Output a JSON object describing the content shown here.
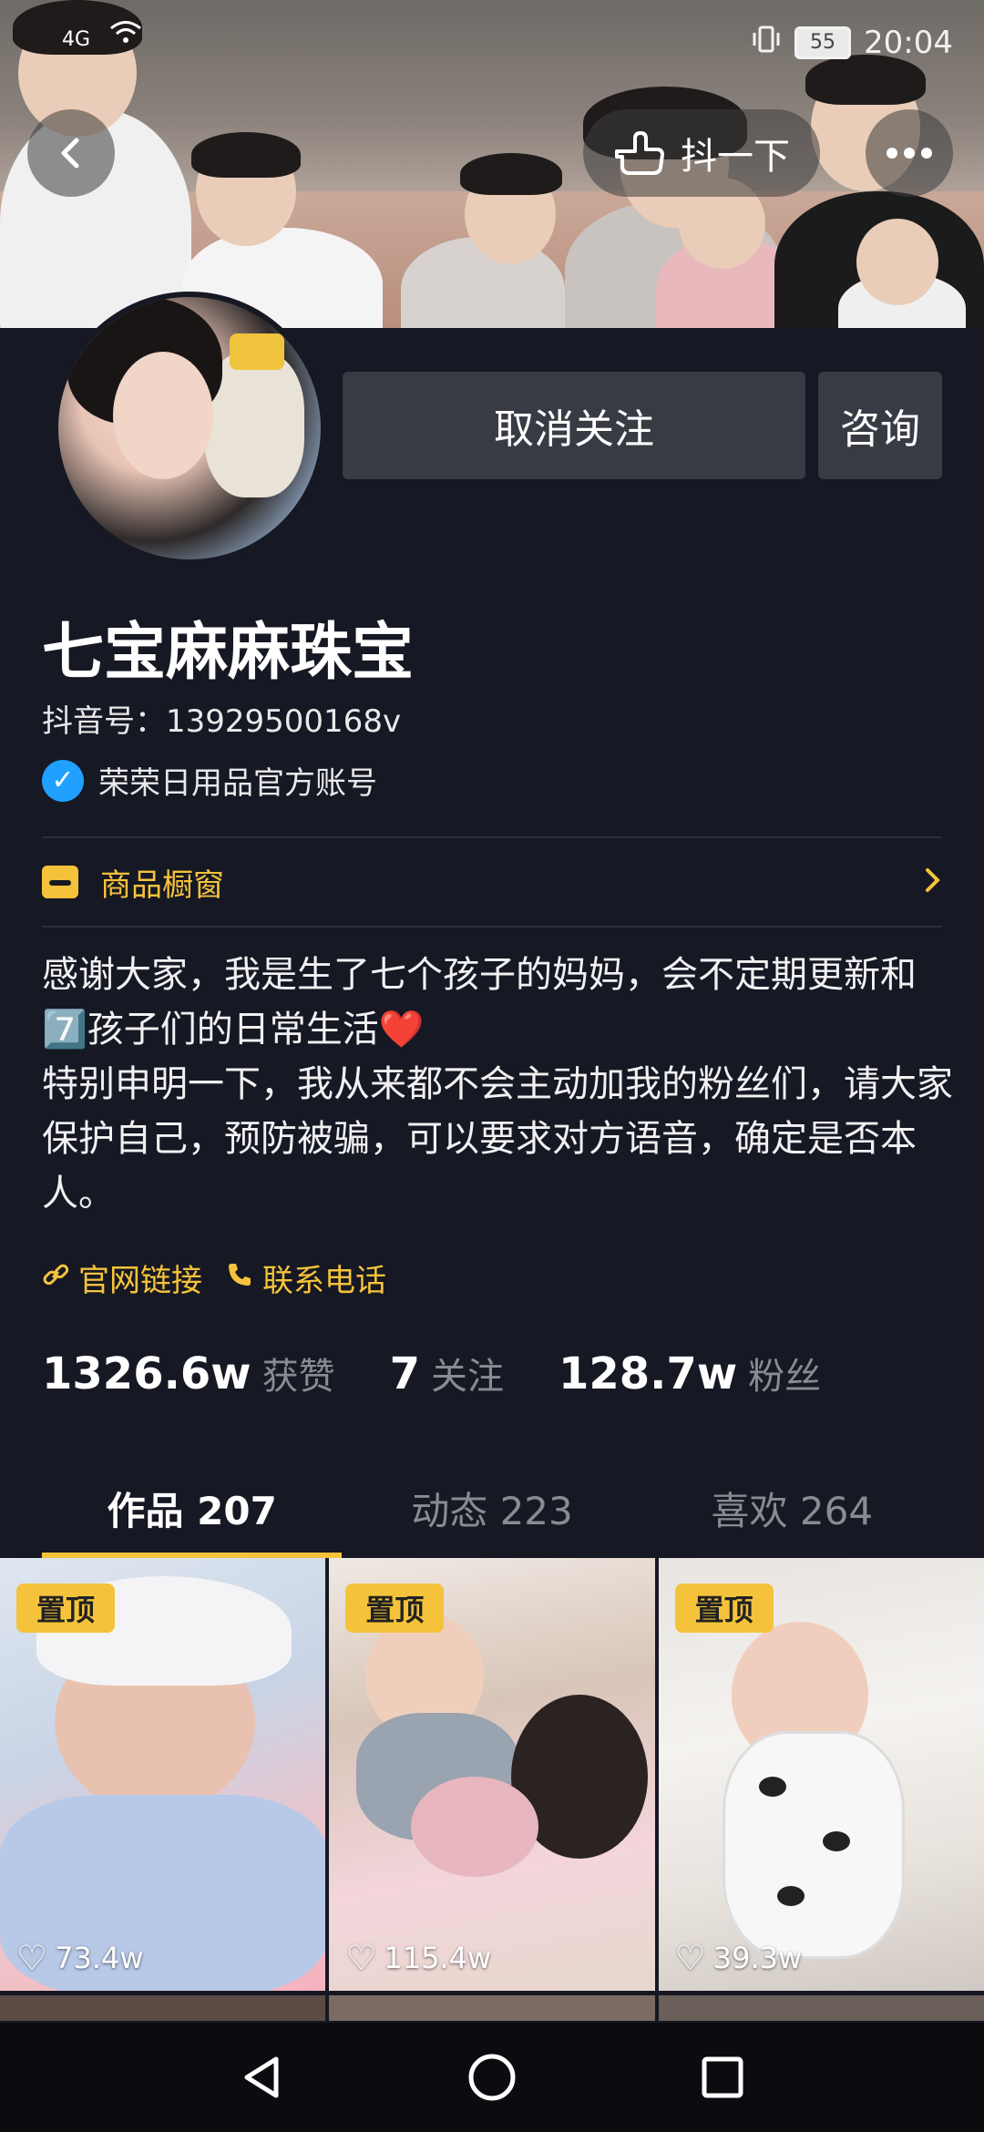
{
  "status_bar": {
    "signal": "4G",
    "battery": "55",
    "time": "20:04"
  },
  "cover": {
    "shake_label": "抖一下"
  },
  "actions": {
    "unfollow_label": "取消关注",
    "consult_label": "咨询"
  },
  "profile": {
    "name": "七宝麻麻珠宝",
    "douyin_id": "抖音号：13929500168v",
    "verified_text": "荣荣日用品官方账号",
    "shop_label": "商品橱窗",
    "bio": "感谢大家，我是生了七个孩子的妈妈，会不定期更新和7️⃣孩子们的日常生活❤️\n特别申明一下，我从来都不会主动加我的粉丝们，请大家保护自己，预防被骗，可以要求对方语音，确定是否本人。",
    "links": [
      {
        "label": "官网链接",
        "icon": "link-icon"
      },
      {
        "label": "联系电话",
        "icon": "phone-icon"
      }
    ]
  },
  "stats": [
    {
      "value": "1326.6w",
      "label": "获赞"
    },
    {
      "value": "7",
      "label": "关注"
    },
    {
      "value": "128.7w",
      "label": "粉丝"
    }
  ],
  "tabs": [
    {
      "label": "作品 207",
      "active": true
    },
    {
      "label": "动态 223",
      "active": false
    },
    {
      "label": "喜欢 264",
      "active": false
    }
  ],
  "videos": [
    {
      "pinned": "置顶",
      "likes": "73.4w"
    },
    {
      "pinned": "置顶",
      "likes": "115.4w"
    },
    {
      "pinned": "置顶",
      "likes": "39.3w"
    }
  ],
  "colors": {
    "background": "#161823",
    "accent": "#f5c33b",
    "button": "#393b44",
    "verified": "#20a0ff"
  }
}
